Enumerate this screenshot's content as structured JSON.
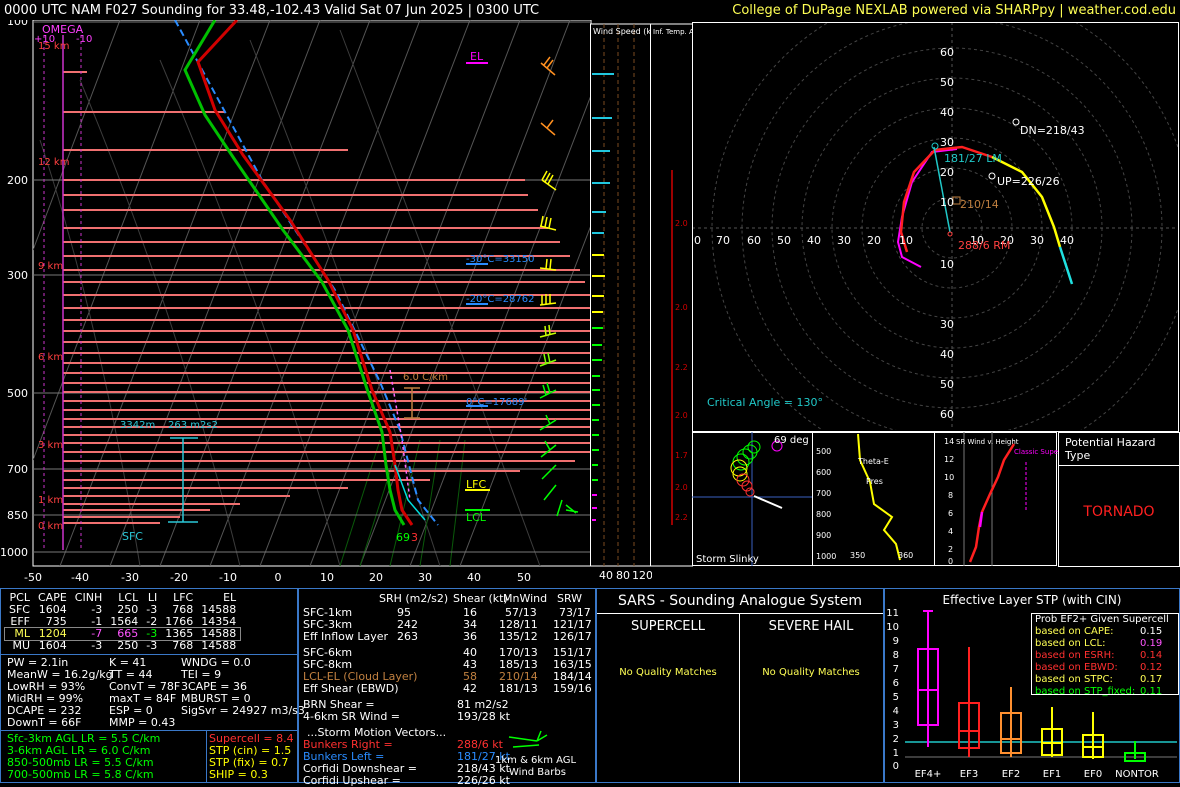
{
  "header": {
    "title": "0000 UTC NAM F027 Sounding for 33.48,-102.43 Valid  Sat 07 Jun 2025 | 0300 UTC",
    "credit": "College of DuPage NEXLAB powered via SHARPpy | weather.cod.edu"
  },
  "skewt": {
    "omega_label": "OMEGA",
    "omega_ticks": [
      "+10",
      "-10"
    ],
    "pressure_labels": [
      "100",
      "200",
      "300",
      "500",
      "700",
      "850",
      "1000"
    ],
    "height_labels": [
      "15 km",
      "12 km",
      "9 km",
      "6 km",
      "3 km",
      "1 km",
      "0 km"
    ],
    "temp_labels": [
      "-50",
      "-40",
      "-30",
      "-20",
      "-10",
      "0",
      "10",
      "20",
      "30",
      "40",
      "50"
    ],
    "el_label": "EL",
    "lfc_label": "LFC",
    "lcl_label": "LCL",
    "isotherm_labels": [
      "-30°C=33150",
      "-20°C=28762",
      "0°C=17689'"
    ],
    "lapse_label": "6.0 C/km",
    "effective_inflow": "3342m",
    "effective_srh": "263 m2s2",
    "sfc_label": "SFC",
    "sfc_temp": "69",
    "sfc_dew": "3"
  },
  "wind_speed": {
    "title": "Wind Speed (knots)",
    "ticks": [
      "40",
      "80",
      "120"
    ]
  },
  "temp_adv": {
    "title": "Inf. Temp. Adv. (C/hr)",
    "values": [
      "2.0",
      "2.0",
      "2.2",
      "2.0",
      "1.7",
      "2.0",
      "2.2"
    ]
  },
  "hodograph": {
    "rings": [
      "10",
      "20",
      "30",
      "40",
      "50",
      "60"
    ],
    "x_labels": [
      "70",
      "60",
      "50",
      "40",
      "30",
      "20",
      "10",
      "0"
    ],
    "dn_label": "DN=218/43",
    "up_label": "UP=226/26",
    "lm_label": "181/27 LM",
    "mean_label": "210/14",
    "rm_label": "288/6 RM",
    "critical_angle": "Critical Angle = 130°"
  },
  "slinky": {
    "label": "Storm Slinky",
    "deg": "69 deg"
  },
  "theta": {
    "label1": "Theta-E",
    "label2": "Pres",
    "y_ticks": [
      "500",
      "600",
      "700",
      "800",
      "900",
      "1000"
    ],
    "x_ticks": [
      "350",
      "360"
    ]
  },
  "srwind": {
    "title": "SR Wind v. Height",
    "y_ticks": [
      "14",
      "12",
      "10",
      "8",
      "6",
      "4",
      "2",
      "0"
    ],
    "classic": "Classic Supercell"
  },
  "hazard": {
    "title": "Potential Hazard Type",
    "value": "TORNADO"
  },
  "parcels": {
    "headers": [
      "PCL",
      "CAPE",
      "CINH",
      "LCL",
      "LI",
      "LFC",
      "EL"
    ],
    "rows": [
      [
        "SFC",
        "1604",
        "-3",
        "250",
        "-3",
        "768",
        "14588"
      ],
      [
        "EFF",
        "735",
        "-1",
        "1564",
        "-2",
        "1766",
        "14354"
      ],
      [
        "ML",
        "1204",
        "-7",
        "665",
        "-3",
        "1365",
        "14588"
      ],
      [
        "MU",
        "1604",
        "-3",
        "250",
        "-3",
        "768",
        "14588"
      ]
    ]
  },
  "indices": {
    "col1": [
      "PW = 2.1in",
      "MeanW = 16.2g/kg",
      "LowRH = 93%",
      "MidRH = 99%",
      "DCAPE = 232",
      "DownT = 66F"
    ],
    "col2": [
      "K = 41",
      "TT = 44",
      "ConvT = 78F",
      "maxT = 84F",
      "ESP = 0",
      "MMP = 0.43"
    ],
    "col3": [
      "WNDG = 0.0",
      "TEI = 9",
      "3CAPE = 36",
      "MBURST = 0",
      "",
      "SigSvr = 24927 m3/s3"
    ]
  },
  "lapse": {
    "rows": [
      "Sfc-3km AGL LR = 5.5 C/km",
      "3-6km AGL LR = 6.0 C/km",
      "850-500mb LR = 5.5 C/km",
      "700-500mb LR = 5.8 C/km"
    ]
  },
  "composites": {
    "rows": [
      "Supercell = 8.4",
      "STP (cin) = 1.5",
      "STP (fix) = 0.7",
      "SHIP = 0.3"
    ]
  },
  "kinematics": {
    "headers": [
      "SRH (m2/s2)",
      "Shear (kt)",
      "MnWind",
      "SRW"
    ],
    "rows": [
      [
        "SFC-1km",
        "95",
        "16",
        "57/13",
        "73/17"
      ],
      [
        "SFC-3km",
        "242",
        "34",
        "128/11",
        "121/17"
      ],
      [
        "Eff Inflow Layer",
        "263",
        "36",
        "135/12",
        "126/17"
      ],
      [
        "",
        "",
        "",
        "",
        ""
      ],
      [
        "SFC-6km",
        "40",
        "170/13",
        "151/17",
        ""
      ],
      [
        "SFC-8km",
        "43",
        "185/13",
        "163/15",
        ""
      ],
      [
        "LCL-EL (Cloud Layer)",
        "58",
        "210/14",
        "184/14",
        ""
      ],
      [
        "Eff Shear (EBWD)",
        "42",
        "181/13",
        "159/16",
        ""
      ]
    ],
    "brn_shear_label": "BRN Shear =",
    "brn_shear": "81 m2/s2",
    "sr_wind_label": "4-6km SR Wind =",
    "sr_wind": "193/28 kt",
    "storm_motion_title": "...Storm Motion Vectors...",
    "storm_motion": [
      {
        "label": "Bunkers Right =",
        "value": "288/6 kt"
      },
      {
        "label": "Bunkers Left =",
        "value": "181/27 kt"
      },
      {
        "label": "Corfidi Downshear =",
        "value": "218/43 kt"
      },
      {
        "label": "Corfidi Upshear =",
        "value": "226/26 kt"
      }
    ],
    "barb_caption1": "1km & 6km AGL",
    "barb_caption2": "Wind Barbs"
  },
  "sars": {
    "title": "SARS - Sounding Analogue System",
    "supercell": "SUPERCELL",
    "hail": "SEVERE HAIL",
    "no_match1": "No Quality Matches",
    "no_match2": "No Quality Matches"
  },
  "stp": {
    "title": "Effective Layer STP (with CIN)",
    "y_ticks": [
      "11",
      "10",
      "9",
      "8",
      "7",
      "6",
      "5",
      "4",
      "3",
      "2",
      "1",
      "0"
    ],
    "categories": [
      "EF4+",
      "EF3",
      "EF2",
      "EF1",
      "EF0",
      "NONTOR"
    ],
    "legend_title": "Prob EF2+ Given Supercell",
    "legend": [
      {
        "label": "based on CAPE:",
        "value": "0.15",
        "color": "#ffffff"
      },
      {
        "label": "based on LCL:",
        "value": "0.19",
        "color": "#ff00ff"
      },
      {
        "label": "based on ESRH:",
        "value": "0.14",
        "color": "#ff3030"
      },
      {
        "label": "based on EBWD:",
        "value": "0.12",
        "color": "#ff3030"
      },
      {
        "label": "based on STPC:",
        "value": "0.17",
        "color": "#ffff00"
      },
      {
        "label": "based on STP_fixed:",
        "value": "0.11",
        "color": "#00ff00"
      }
    ]
  }
}
